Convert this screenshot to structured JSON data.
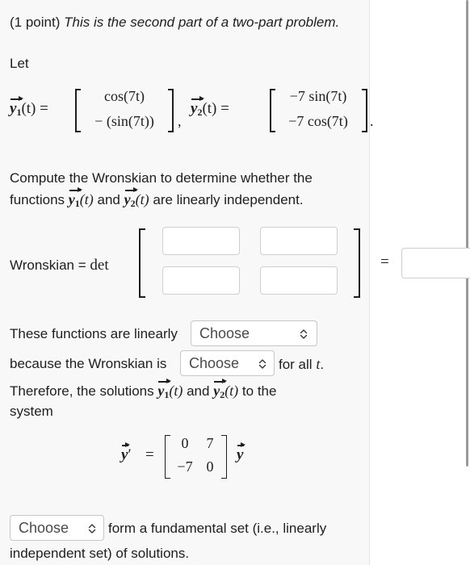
{
  "header": {
    "prefix": "(1 point)",
    "title": "This is the second part of a two-part problem."
  },
  "let_label": "Let",
  "vectors": {
    "y1": {
      "name": "y",
      "sub": "1",
      "arg": "(t) =",
      "row1": "cos(7t)",
      "row2": "− (sin(7t))"
    },
    "y2": {
      "name": "y",
      "sub": "2",
      "arg": "(t) =",
      "row1": "−7 sin(7t)",
      "row2": "−7 cos(7t)"
    },
    "comma": ",",
    "period": "."
  },
  "instruction": {
    "line1": "Compute the Wronskian to determine whether the",
    "line2_a": "functions",
    "line2_b": "and",
    "line2_c": "are linearly independent.",
    "arg": "(t)"
  },
  "wronskian": {
    "label": "Wronskian =",
    "det": "det",
    "equals": "=",
    "inputs": {
      "r1c1": "",
      "r1c2": "",
      "r2c1": "",
      "r2c2": "",
      "result": ""
    }
  },
  "statements": {
    "s1": "These functions are linearly",
    "s2": "because the Wronskian is",
    "s2_end": "for all",
    "t": "t",
    "period": ".",
    "s3_a": "Therefore, the solutions",
    "s3_b": "and",
    "s3_c": "to the",
    "s4": "system",
    "s5": "form a fundamental set (i.e., linearly",
    "s6": "independent set) of solutions."
  },
  "selects": {
    "linearly": "Choose",
    "wronskian": "Choose",
    "fundamental": "Choose"
  },
  "system": {
    "lhs_sym": "y",
    "prime": "′",
    "equals": "=",
    "matrix": [
      [
        "0",
        "7"
      ],
      [
        "−7",
        "0"
      ]
    ],
    "rhs_sym": "y"
  },
  "colors": {
    "card_bg": "#f8f8f8",
    "text": "#1e1e1e",
    "select_text": "#4a4a4a"
  }
}
